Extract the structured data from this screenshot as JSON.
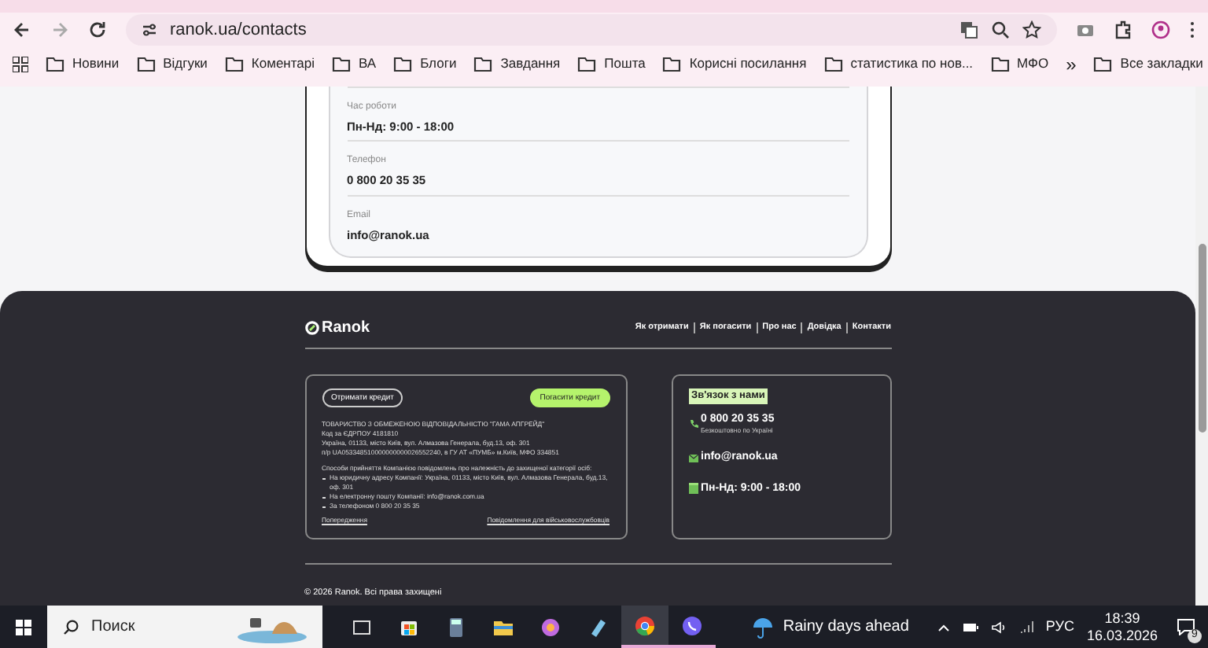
{
  "browser": {
    "address": "ranok.ua/contacts",
    "bookmarks": [
      "Новини",
      "Відгуки",
      "Коментарі",
      "ВА",
      "Блоги",
      "Завдання",
      "Пошта",
      "Корисні посилання",
      "статистика по нов...",
      "МФО"
    ],
    "more": "»",
    "all_bookmarks": "Все закладки"
  },
  "contact_fields": [
    {
      "label": "Час роботи",
      "value": "Пн-Нд: 9:00 - 18:00"
    },
    {
      "label": "Телефон",
      "value": "0 800 20 35 35"
    },
    {
      "label": "Email",
      "value": "info@ranok.ua"
    }
  ],
  "footer": {
    "logo": "Ranok",
    "nav": [
      "Як отримати",
      "Як погасити",
      "Про нас",
      "Довідка",
      "Контакти"
    ],
    "company": {
      "buttons": [
        {
          "label": "Отримати кредит",
          "kind": "outline"
        },
        {
          "label": "Погасити кредит",
          "kind": "accent"
        }
      ],
      "legal": [
        "ТОВАРИСТВО З ОБМЕЖЕНОЮ ВІДПОВІДАЛЬНІСТЮ \"ГАМА АПГРЕЙД\"",
        "Код за ЄДРПОУ 4181810",
        "Україна, 01133, місто Київ, вул. Алмазова Генерала, буд.13, оф. 301",
        "п/р UA053348510000000000026552240, в ГУ АТ «ПУМБ» м.Київ, МФО 334851"
      ],
      "methods_title": "Способи прийняття Компанією повідомлень про належність до захищеної категорії осіб:",
      "methods": [
        "На юридичну адресу Компанії: Україна, 01133, місто Київ, вул. Алмазова Генерала, буд.13, оф. 301",
        "На електронну пошту Компанії: info@ranok.com.ua",
        "За телефоном 0 800 20 35 35"
      ],
      "links": [
        "Попередження",
        "Повідомлення для військовослужбовців"
      ]
    },
    "contact": {
      "title": "Зв'язок з нами",
      "phone": "0 800 20 35 35",
      "phone_note": "Безкоштовно по Україні",
      "email": "info@ranok.ua",
      "hours": "Пн-Нд: 9:00 - 18:00"
    },
    "copyright": "© 2026 Ranok. Всі права захищені"
  },
  "taskbar": {
    "search_placeholder": "Поиск",
    "weather": "Rainy days ahead",
    "language": "РУС",
    "time": "18:39",
    "date": "16.03.2026",
    "notifications": "9"
  }
}
